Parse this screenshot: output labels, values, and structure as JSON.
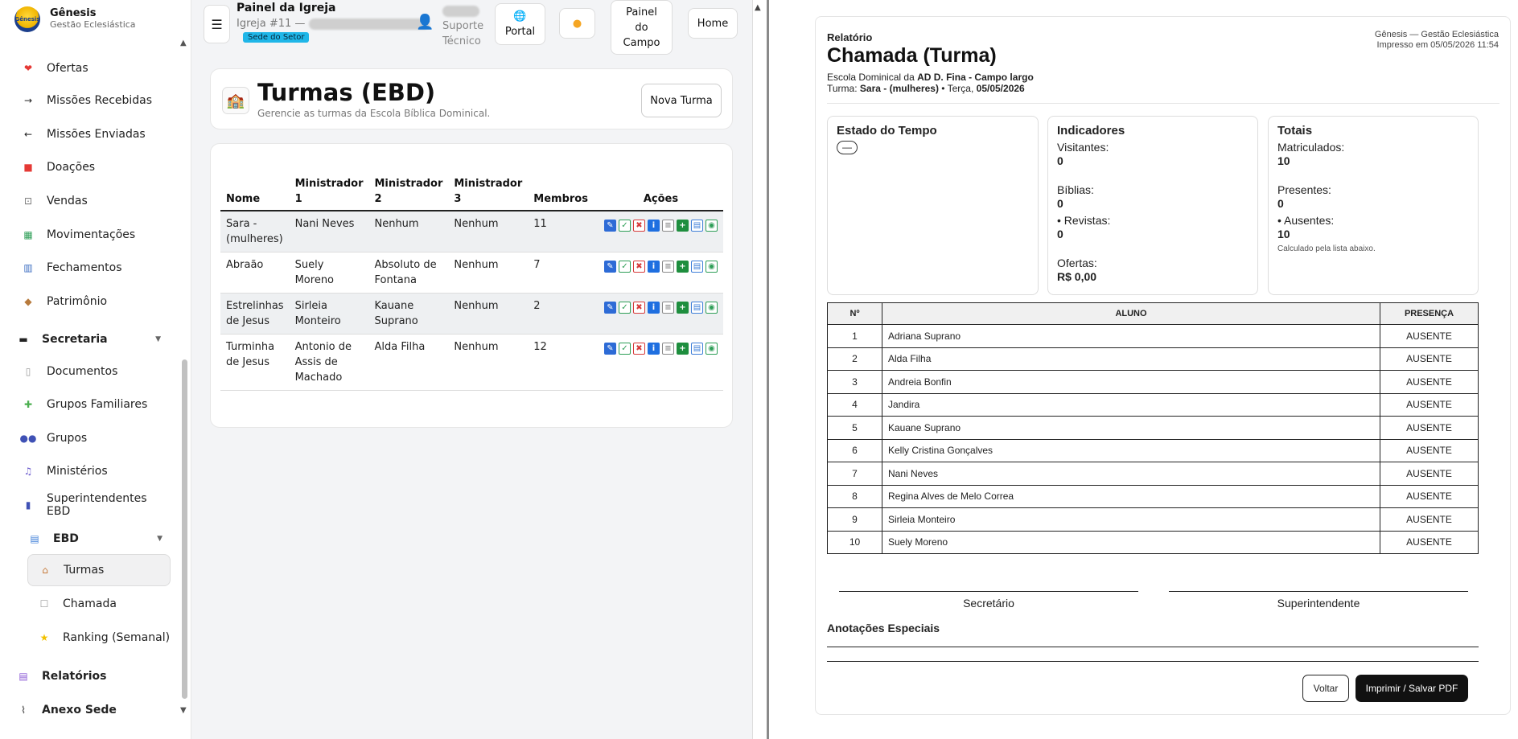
{
  "brand": {
    "title": "Gênesis",
    "subtitle": "Gestão Eclesiástica",
    "logo_text": "Gênesis"
  },
  "sidebar": {
    "items": [
      {
        "label": "Ofertas",
        "icon": "heart-icon"
      },
      {
        "label": "Missões Recebidas",
        "icon": "arrow-right-icon"
      },
      {
        "label": "Missões Enviadas",
        "icon": "arrow-left-icon"
      },
      {
        "label": "Doações",
        "icon": "gift-icon"
      },
      {
        "label": "Vendas",
        "icon": "cart-icon"
      },
      {
        "label": "Movimentações",
        "icon": "chart-icon"
      },
      {
        "label": "Fechamentos",
        "icon": "bar-chart-icon"
      },
      {
        "label": "Patrimônio",
        "icon": "box-icon"
      }
    ],
    "secretaria": {
      "label": "Secretaria",
      "items": [
        {
          "label": "Documentos"
        },
        {
          "label": "Grupos Familiares"
        },
        {
          "label": "Grupos"
        },
        {
          "label": "Ministérios"
        },
        {
          "label": "Superintendentes EBD"
        }
      ]
    },
    "ebd": {
      "label": "EBD",
      "items": [
        {
          "label": "Turmas"
        },
        {
          "label": "Chamada"
        },
        {
          "label": "Ranking (Semanal)"
        }
      ]
    },
    "relatorios": "Relatórios",
    "anexo": "Anexo Sede"
  },
  "topbar": {
    "panel_title": "Painel da Igreja",
    "church_prefix": "Igreja #11 —",
    "badge": "Sede do Setor",
    "support_label": "Suporte",
    "support_label2": "Técnico",
    "portal": "Portal",
    "painel_campo": [
      "Painel",
      "do",
      "Campo"
    ],
    "home": "Home"
  },
  "page": {
    "title": "Turmas (EBD)",
    "subtitle": "Gerencie as turmas da Escola Bíblica Dominical.",
    "new_button": "Nova Turma"
  },
  "table": {
    "headers": [
      "Nome",
      "Ministrador 1",
      "Ministrador 2",
      "Ministrador 3",
      "Membros",
      "Ações"
    ],
    "header_lines": [
      [
        "Nome"
      ],
      [
        "Ministrador",
        "1"
      ],
      [
        "Ministrador",
        "2"
      ],
      [
        "Ministrador",
        "3"
      ],
      [
        "Membros"
      ],
      [
        "Ações"
      ]
    ],
    "rows": [
      {
        "nome": "Sara - (mulheres)",
        "m1": "Nani Neves",
        "m2": "Nenhum",
        "m3": "Nenhum",
        "membros": "11"
      },
      {
        "nome": "Abraão",
        "m1": "Suely Moreno",
        "m2": "Absoluto de Fontana",
        "m3": "Nenhum",
        "membros": "7"
      },
      {
        "nome": "Estrelinhas de Jesus",
        "m1": "Sirleia Monteiro",
        "m2": "Kauane Suprano",
        "m3": "Nenhum",
        "membros": "2"
      },
      {
        "nome": "Turminha de Jesus",
        "m1": "Antonio de Assis de Machado",
        "m2": "Alda Filha",
        "m3": "Nenhum",
        "membros": "12"
      }
    ]
  },
  "report": {
    "kicker": "Relatório",
    "title": "Chamada (Turma)",
    "school_prefix": "Escola Dominical",
    "school_mid": "da",
    "school_name": "AD D. Fina - Campo largo",
    "turma_label": "Turma:",
    "turma_name": "Sara - (mulheres)",
    "turma_sep": "•",
    "turma_day": "Terça,",
    "turma_date": "05/05/2026",
    "meta_app": "Gênesis — Gestão Eclesiástica",
    "meta_printed": "Impresso em 05/05/2026 11:54",
    "estado": {
      "title": "Estado do Tempo",
      "value": "—"
    },
    "indicadores": {
      "title": "Indicadores",
      "visitantes_label": "Visitantes:",
      "visitantes": "0",
      "biblias_label": "Bíblias:",
      "biblias": "0",
      "revistas_label": "• Revistas:",
      "revistas": "0",
      "ofertas_label": "Ofertas:",
      "ofertas": "R$ 0,00"
    },
    "totais": {
      "title": "Totais",
      "matriculados_label": "Matriculados:",
      "matriculados": "10",
      "presentes_label": "Presentes:",
      "presentes": "0",
      "ausentes_label": "• Ausentes:",
      "ausentes": "10",
      "note": "Calculado pela lista abaixo."
    },
    "attendance_headers": [
      "Nº",
      "ALUNO",
      "PRESENÇA"
    ],
    "attendance": [
      {
        "n": "1",
        "aluno": "Adriana Suprano",
        "presenca": "AUSENTE"
      },
      {
        "n": "2",
        "aluno": "Alda Filha",
        "presenca": "AUSENTE"
      },
      {
        "n": "3",
        "aluno": "Andreia Bonfin",
        "presenca": "AUSENTE"
      },
      {
        "n": "4",
        "aluno": "Jandira",
        "presenca": "AUSENTE"
      },
      {
        "n": "5",
        "aluno": "Kauane Suprano",
        "presenca": "AUSENTE"
      },
      {
        "n": "6",
        "aluno": "Kelly Cristina Gonçalves",
        "presenca": "AUSENTE"
      },
      {
        "n": "7",
        "aluno": "Nani Neves",
        "presenca": "AUSENTE"
      },
      {
        "n": "8",
        "aluno": "Regina Alves de Melo Correa",
        "presenca": "AUSENTE"
      },
      {
        "n": "9",
        "aluno": "Sirleia Monteiro",
        "presenca": "AUSENTE"
      },
      {
        "n": "10",
        "aluno": "Suely Moreno",
        "presenca": "AUSENTE"
      }
    ],
    "sig_secretario": "Secretário",
    "sig_superintendente": "Superintendente",
    "anotacoes": "Anotações Especiais",
    "btn_voltar": "Voltar",
    "btn_print": "Imprimir / Salvar PDF"
  },
  "colors": {
    "badge": "#1fb6e8",
    "accent": "#111111",
    "row_alt": "#eef0f2"
  }
}
